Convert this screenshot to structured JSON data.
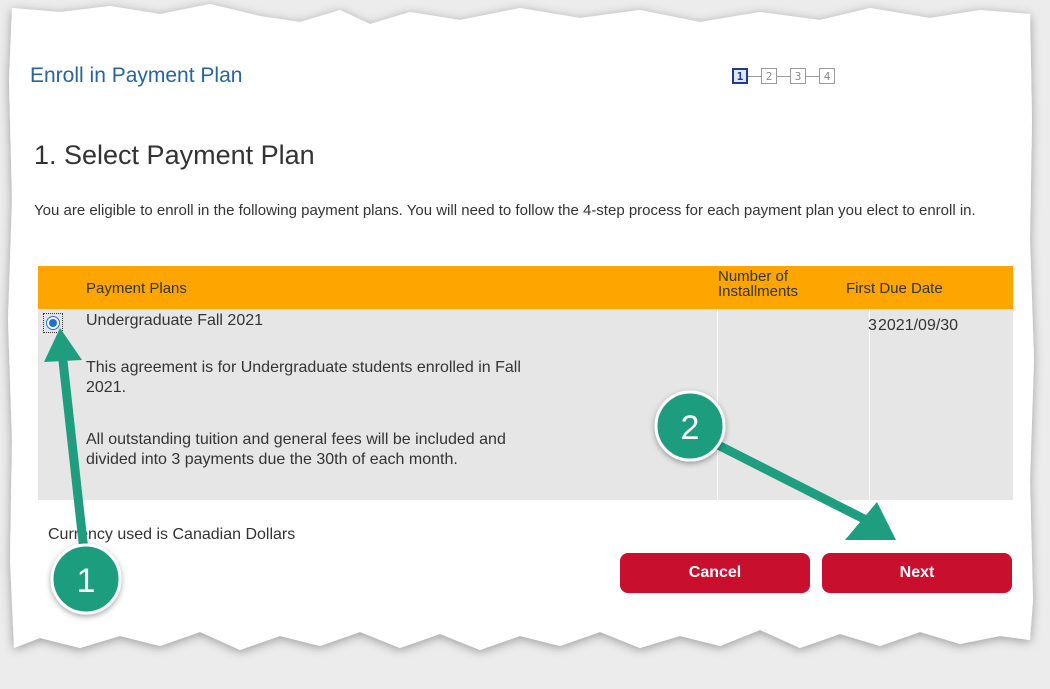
{
  "header": {
    "title": "Enroll in Payment Plan",
    "steps": [
      "1",
      "2",
      "3",
      "4"
    ],
    "active_step": 1
  },
  "section": {
    "title": "1. Select Payment Plan",
    "intro": "You are eligible to enroll in the following payment plans. You will need to follow the 4-step process for each payment plan you elect to enroll in."
  },
  "table": {
    "headers": {
      "plan": "Payment Plans",
      "installments": "Number of Installments",
      "due": "First Due Date"
    },
    "rows": [
      {
        "selected": true,
        "plan": "Undergraduate Fall 2021",
        "description_1": "This agreement is for Undergraduate students enrolled in Fall 2021.",
        "description_2": "All outstanding tuition and general fees will be included and divided into 3 payments due the 30th of each month.",
        "installments": "3",
        "due": "2021/09/30"
      }
    ]
  },
  "currency_note": "Currency used is Canadian Dollars",
  "buttons": {
    "cancel": "Cancel",
    "next": "Next"
  },
  "annotations": {
    "badge_1": "1",
    "badge_2": "2",
    "color": "#1e9e7e"
  },
  "colors": {
    "header_bg": "#ffa500",
    "button_bg": "#c8102e",
    "title_blue": "#2a6496"
  }
}
